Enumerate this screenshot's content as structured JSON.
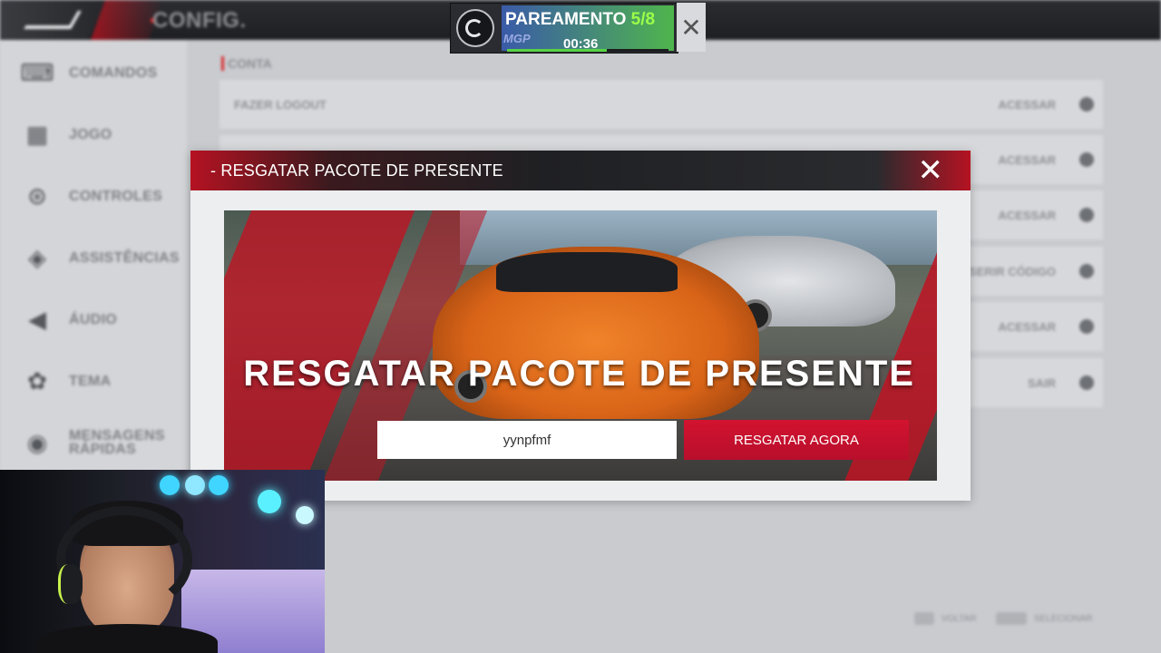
{
  "header": {
    "title": "CONFIG."
  },
  "sidebar": {
    "items": [
      {
        "label": "COMANDOS",
        "icon": "keyboard-icon"
      },
      {
        "label": "JOGO",
        "icon": "grid-icon"
      },
      {
        "label": "CONTROLES",
        "icon": "steering-wheel-icon"
      },
      {
        "label": "ASSISTÊNCIAS",
        "icon": "assist-icon"
      },
      {
        "label": "ÁUDIO",
        "icon": "speaker-icon"
      },
      {
        "label": "TEMA",
        "icon": "palette-icon"
      },
      {
        "label": "MENSAGENS RÁPIDAS",
        "icon": "chat-icon"
      }
    ]
  },
  "account": {
    "section_label": "CONTA",
    "rows": [
      {
        "label": "FAZER LOGOUT",
        "action": "ACESSAR"
      },
      {
        "label": "",
        "action": "ACESSAR"
      },
      {
        "label": "",
        "action": "ACESSAR"
      },
      {
        "label": "",
        "action": "INSERIR CÓDIGO"
      },
      {
        "label": "",
        "action": "ACESSAR"
      },
      {
        "label": "",
        "action": "SAIR"
      }
    ]
  },
  "footer": {
    "back_label": "VOLTAR",
    "select_label": "SELECIONAR"
  },
  "matchmaking": {
    "title": "PAREAMENTO",
    "count": "5/8",
    "sub_label": "MGP",
    "timer": "00:36",
    "progress": 0.62,
    "close_icon": "close-icon"
  },
  "dialog": {
    "title": "- RESGATAR PACOTE DE PRESENTE",
    "banner_title": "RESGATAR PACOTE DE PRESENTE",
    "code_value": "yynpfmf",
    "redeem_label": "RESGATAR AGORA",
    "accent_color": "#d2132f"
  }
}
